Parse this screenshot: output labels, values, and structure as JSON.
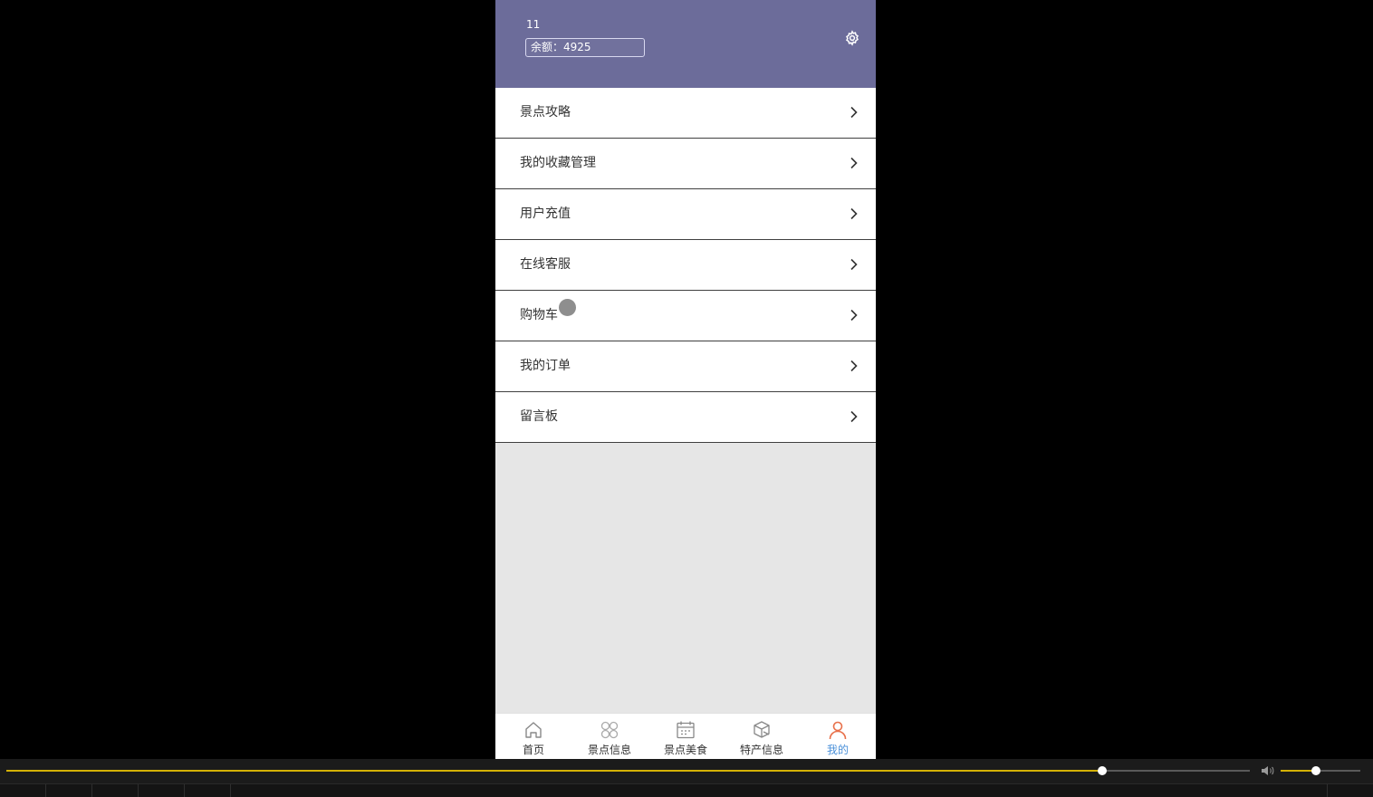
{
  "header": {
    "username": "11",
    "balance_text": "余额：4925",
    "settings_icon": "gear-icon",
    "background": "#6c6c9a"
  },
  "menu": {
    "items": [
      {
        "label": "景点攻略",
        "icon": "chevron-right-icon"
      },
      {
        "label": "我的收藏管理",
        "icon": "chevron-right-icon"
      },
      {
        "label": "用户充值",
        "icon": "chevron-right-icon"
      },
      {
        "label": "在线客服",
        "icon": "chevron-right-icon"
      },
      {
        "label": "购物车",
        "icon": "chevron-right-icon"
      },
      {
        "label": "我的订单",
        "icon": "chevron-right-icon"
      },
      {
        "label": "留言板",
        "icon": "chevron-right-icon"
      }
    ]
  },
  "tabbar": {
    "active_index": 4,
    "active_color": "#4a90d9",
    "items": [
      {
        "label": "首页",
        "icon": "home-icon"
      },
      {
        "label": "景点信息",
        "icon": "grid-icon"
      },
      {
        "label": "景点美食",
        "icon": "calendar-icon"
      },
      {
        "label": "特产信息",
        "icon": "box-icon"
      },
      {
        "label": "我的",
        "icon": "user-icon"
      }
    ]
  },
  "player": {
    "progress_fraction": 0.881,
    "volume_fraction": 0.44,
    "accent": "#d4b106"
  }
}
